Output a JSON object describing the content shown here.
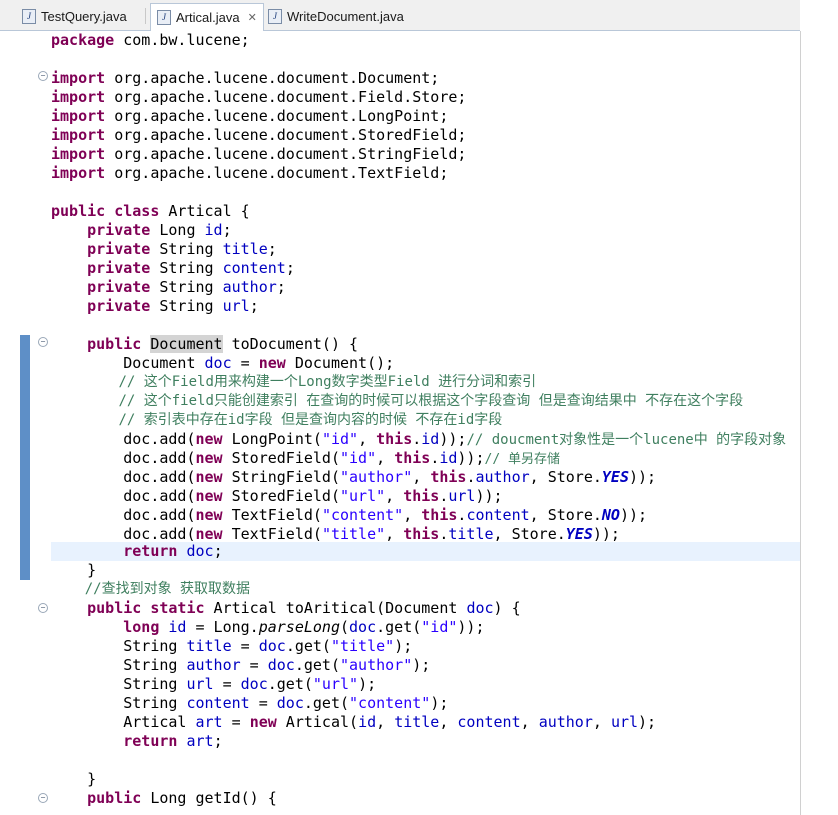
{
  "tabs": [
    {
      "label": "TestQuery.java"
    },
    {
      "label": "Artical.java"
    },
    {
      "label": "WriteDocument.java"
    }
  ],
  "code": {
    "l1": [
      "package",
      " com.bw.lucene;"
    ],
    "imports": [
      " org.apache.lucene.document.Document;",
      " org.apache.lucene.document.Field.Store;",
      " org.apache.lucene.document.LongPoint;",
      " org.apache.lucene.document.StoredField;",
      " org.apache.lucene.document.StringField;",
      " org.apache.lucene.document.TextField;"
    ],
    "kw_import": "import",
    "class_decl": [
      "public class",
      " Artical {"
    ],
    "fields": [
      {
        "kw": "private",
        "type": " Long ",
        "name": "id"
      },
      {
        "kw": "private",
        "type": " String ",
        "name": "title"
      },
      {
        "kw": "private",
        "type": " String ",
        "name": "content"
      },
      {
        "kw": "private",
        "type": " String ",
        "name": "author"
      },
      {
        "kw": "private",
        "type": " String ",
        "name": "url"
      }
    ],
    "method1_sig": [
      "public",
      " ",
      "Document",
      " toDocument() {"
    ],
    "m1_l1": [
      "Document ",
      "doc",
      " = ",
      "new",
      " Document();"
    ],
    "m1_c1": "// 这个Field用来构建一个Long数字类型Field 进行分词和索引",
    "m1_c2": "// 这个field只能创建索引 在查询的时候可以根据这个字段查询 但是查询结果中 不存在这个字段",
    "m1_c3": "// 索引表中存在id字段 但是查询内容的时候 不存在id字段",
    "m1_add1": [
      "doc",
      ".add(",
      "new",
      " LongPoint(",
      "\"id\"",
      ", ",
      "this",
      ".",
      "id",
      "));",
      "// doucment对象性是一个lucene中 的字段对象"
    ],
    "m1_add2": [
      "doc",
      ".add(",
      "new",
      " StoredField(",
      "\"id\"",
      ", ",
      "this",
      ".",
      "id",
      "));",
      "// 单另存储"
    ],
    "m1_add3": [
      "doc",
      ".add(",
      "new",
      " StringField(",
      "\"author\"",
      ", ",
      "this",
      ".",
      "author",
      ", Store.",
      "YES",
      "));"
    ],
    "m1_add4": [
      "doc",
      ".add(",
      "new",
      " StoredField(",
      "\"url\"",
      ", ",
      "this",
      ".",
      "url",
      "));"
    ],
    "m1_add5": [
      "doc",
      ".add(",
      "new",
      " TextField(",
      "\"content\"",
      ", ",
      "this",
      ".",
      "content",
      ", Store.",
      "NO",
      "));"
    ],
    "m1_add6": [
      "doc",
      ".add(",
      "new",
      " TextField(",
      "\"title\"",
      ", ",
      "this",
      ".",
      "title",
      ", Store.",
      "YES",
      "));"
    ],
    "m1_ret": [
      "return",
      " ",
      "doc",
      ";"
    ],
    "close_brace": "}",
    "m2_comment": "//查找到对象 获取取数据",
    "method2_sig": [
      "public static",
      " Artical toAritical(Document ",
      "doc",
      ") {"
    ],
    "m2_l1": [
      "long",
      " ",
      "id",
      " = Long.",
      "parseLong",
      "(",
      "doc",
      ".get(",
      "\"id\"",
      "));"
    ],
    "m2_l2": [
      "String ",
      "title",
      " = ",
      "doc",
      ".get(",
      "\"title\"",
      ");"
    ],
    "m2_l3": [
      "String ",
      "author",
      " = ",
      "doc",
      ".get(",
      "\"author\"",
      ");"
    ],
    "m2_l4": [
      "String ",
      "url",
      " = ",
      "doc",
      ".get(",
      "\"url\"",
      ");"
    ],
    "m2_l5": [
      "String ",
      "content",
      " = ",
      "doc",
      ".get(",
      "\"content\"",
      ");"
    ],
    "m2_l6": [
      "Artical ",
      "art",
      " = ",
      "new",
      " Artical(",
      "id",
      ", ",
      "title",
      ", ",
      "content",
      ", ",
      "author",
      ", ",
      "url",
      ");"
    ],
    "m2_ret": [
      "return",
      " ",
      "art",
      ";"
    ],
    "last": [
      "public",
      " Long getId() {"
    ]
  },
  "colors": {
    "keyword": "#7f0055",
    "field": "#0000c0",
    "string": "#2a00ff",
    "comment": "#3f7f5f",
    "current_line": "#e8f2fe",
    "change_bar": "#5e8fc7"
  }
}
